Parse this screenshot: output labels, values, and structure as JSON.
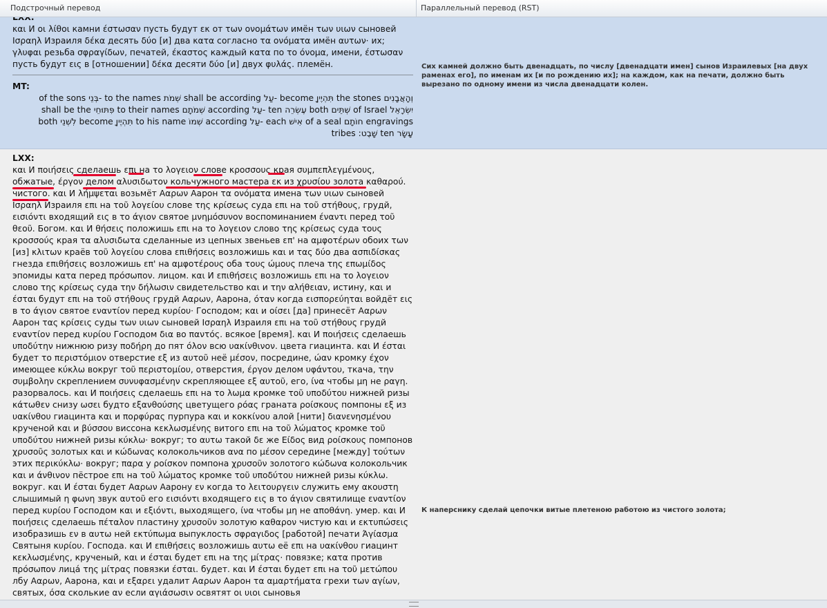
{
  "header": {
    "col1_label": "Подстрочный перевод",
    "col2_label": "Параллельный перевод (RST)"
  },
  "row1": {
    "lxx_partial_tag": "LXX:",
    "lxx_text": "και И οι λίθοι камни έστωσαν пусть будут εκ от των ονομάτων имён των υιων сыновей Ισραηλ Израиля δέκα десять δύο [и] два κατα согласно τα ονόματα имён αυτων· их; γλυφαι резьба σφραγίδων, печатей, έκαστος каждый κατα по το όνομα, имени, έστωσαν пусть будут εις в [отношении] δέκα десяти δύο [и] двух φυλάς. племён.",
    "mt_tag": "MT:",
    "mt_line1": "of the sons בְּנֵי- to the names שְׁמֹת shall be according עַל- become תִּהְיֶיןָ the stones וְהָאֲבָנִים",
    "mt_line2": "shall be the פִּתּוּחֵי to their names שְׁמֹתָם according עַל- ten עֶשְׂרֵה both שְׁתֵּים of Israel יִשְׂרָאֵל",
    "mt_line3": "both לִשְׁנֵי become תִּהְיֶיןָ to his name שְׁמוֹ according עַל- each אִישׁ of a seal חוֹתָם engravings",
    "mt_line4": "tribes :שָׁבֶט ten עָשָׂר",
    "rst": "Сих камней должно быть двенадцать, по числу [двенадцати имен] сынов Израилевых [на двух раменах его], по именам их [и по рождению их]; на каждом, как на печати, должно быть вырезано по одному имени из числа двенадцати колен."
  },
  "row2": {
    "lxx_tag": "LXX:",
    "lxx_text": "και И ποιήσεις сделаешь επι на το λογειον слове κροσσους края συμπεπλεγμένους, обжатые, έργον делом αλυσιδωτον кольчужного мастера εκ из χρυσίου золота καθαρού. чистого. και И λήμψεται возьмёт Ααρων Аарон τα ονόματα имена των υιων сыновей Ισραηλ Израиля επι на τοῦ λογείου слове της κρίσεως суда επι на τοῦ στήθους, грудй, εισιόντι входящий εις в το άγιον святое μνημόσυνον воспоминанием έναντι перед τοῦ θεοῦ. Богом. και И θήσεις положишь επι на το λογειον слово της κρίσεως суда τους κροσσούς края τα αλυσιδωτα сделанные из цепных звеньев επ' на αμφοτέρων обоих των [из] κλιτων краёв τοῦ λογείου слова επιθήσεις возложишь και и τας δύο два ασπιδίσκας гнезда επιθήσεις возложишь επ' на αμφοτέρους оба τους ώμους плеча της επωμίδος эпомиды κατα перед πρόσωπον. лицом. και И επιθήσεις возложишь επι на το λογειον слово της κρίσεως суда την δήλωσιν свидетельство και и την αλήθειαν, истину, και и έσται будут επι на τοῦ στήθους грудй Ααρων, Аарона, όταν когда εισπορεύηται войдёт εις в το άγιον святое εναντίον перед κυρίου· Господом; και и οίσει [да] принесёт Ααρων Аарон τας κρίσεις суды των υιων сыновей Ισραηλ Израиля επι на τοῦ στήθους грудй εναντίον перед κυρίου Господом δια во παντός. всякое [время]. και И ποιήσεις сделаешь υποδύτην нижнюю ризу ποδήρη до пят όλον всю υακίνθινον. цвета гиацинта. και И έσται будет το περιστόμιον отверстие εξ из αυτοῦ неё μέσον, посредине, ώαν кромку έχον имеющее κύκλω вокруг τοῦ περιστομίου, отверстия, έργον делом υφάντου, ткача, την συμβολην скреплением συνυφασμένην скрепляющее εξ αυτοῦ, его, ίνα чтобы μη не ραγη. разорвалось. και И ποιήσεις сделаешь επι на το λωμα кромке τοῦ υποδύτου нижней ризы κάτωθεν снизу ωσει будто εξανθούσης цветущего ρόας граната ροίσκους помпоны εξ из υακίνθου гиацинта και и πορφύρας пурпура και и κοκκίνου алой [нити] διανενησμένου крученой και и βύσσου виссона κεκλωσμένης витого επι на τοῦ λώματος кромке τοῦ υποδύτου нижней ризы κύκλω· вокруг; το αυτω такой δε же Είδος вид ροίσκους помпонов χρυσοῦς золотых και и κώδωνας колокольчиков ανα по μέσον середине [между] τούτων этих περικύκλω· вокруг; παρα у ροίσκον помпона χρυσοῦν золотого κώδωνα колокольчик και и άνθινον пёстрое επι на τοῦ λώματος кромке τοῦ υποδύτου нижней ризы κύκλω. вокруг. και И έσται будет Ααρων Аарону εν когда το λειτουργειν служить ему ακουστη слышимый η φωνη звук αυτοῦ его εισιόντι входящего εις в το άγιον святилище εναντίον перед κυρίου Господом και и εξιόντι, выходящего, ίνα чтобы μη не αποθάνη. умер. και И ποιήσεις сделаешь πέταλον пластину χρυσοῦν золотую καθαρον чистую και и εκτυπώσεις изобразишь εν в αυτω ней εκτύπωμα выпуклость σφραγιδος [работой] печати Άγίασμα Святыня κυρίου. Господа. και И επιθήσεις возложишь αυτω её επι на υακίνθου гиацинт κεκλωσμένης, крученый, και и έσται будет επι на της μίτρας· повязке; κατα против πρόσωπον лицá της μίτρας повязки έσται. будет. και И έσται будет επι на τοῦ μετώπου лбу Ααρων, Аарона, και и εξαρει удалит Ααρων Аарон τα αμαρτήματα грехи των αγίων, святых, όσα сколькие αν если αγιάσωσιν освятят οι υιοι сыновья",
    "rst": "К наперснику сделай цепочки витые плетеною работою из чистого золота;"
  }
}
